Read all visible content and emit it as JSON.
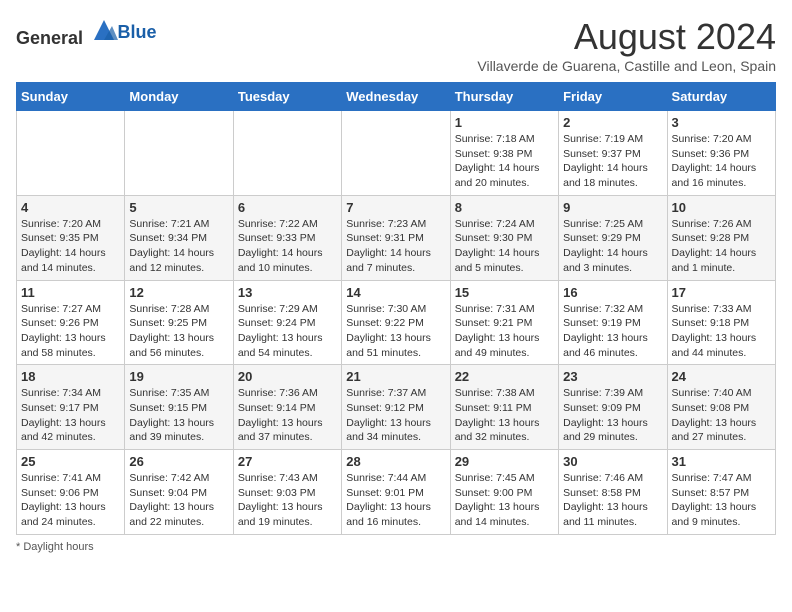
{
  "header": {
    "logo_general": "General",
    "logo_blue": "Blue",
    "month_title": "August 2024",
    "subtitle": "Villaverde de Guarena, Castille and Leon, Spain"
  },
  "weekdays": [
    "Sunday",
    "Monday",
    "Tuesday",
    "Wednesday",
    "Thursday",
    "Friday",
    "Saturday"
  ],
  "weeks": [
    [
      {
        "day": "",
        "sunrise": "",
        "sunset": "",
        "daylight": ""
      },
      {
        "day": "",
        "sunrise": "",
        "sunset": "",
        "daylight": ""
      },
      {
        "day": "",
        "sunrise": "",
        "sunset": "",
        "daylight": ""
      },
      {
        "day": "",
        "sunrise": "",
        "sunset": "",
        "daylight": ""
      },
      {
        "day": "1",
        "sunrise": "Sunrise: 7:18 AM",
        "sunset": "Sunset: 9:38 PM",
        "daylight": "Daylight: 14 hours and 20 minutes."
      },
      {
        "day": "2",
        "sunrise": "Sunrise: 7:19 AM",
        "sunset": "Sunset: 9:37 PM",
        "daylight": "Daylight: 14 hours and 18 minutes."
      },
      {
        "day": "3",
        "sunrise": "Sunrise: 7:20 AM",
        "sunset": "Sunset: 9:36 PM",
        "daylight": "Daylight: 14 hours and 16 minutes."
      }
    ],
    [
      {
        "day": "4",
        "sunrise": "Sunrise: 7:20 AM",
        "sunset": "Sunset: 9:35 PM",
        "daylight": "Daylight: 14 hours and 14 minutes."
      },
      {
        "day": "5",
        "sunrise": "Sunrise: 7:21 AM",
        "sunset": "Sunset: 9:34 PM",
        "daylight": "Daylight: 14 hours and 12 minutes."
      },
      {
        "day": "6",
        "sunrise": "Sunrise: 7:22 AM",
        "sunset": "Sunset: 9:33 PM",
        "daylight": "Daylight: 14 hours and 10 minutes."
      },
      {
        "day": "7",
        "sunrise": "Sunrise: 7:23 AM",
        "sunset": "Sunset: 9:31 PM",
        "daylight": "Daylight: 14 hours and 7 minutes."
      },
      {
        "day": "8",
        "sunrise": "Sunrise: 7:24 AM",
        "sunset": "Sunset: 9:30 PM",
        "daylight": "Daylight: 14 hours and 5 minutes."
      },
      {
        "day": "9",
        "sunrise": "Sunrise: 7:25 AM",
        "sunset": "Sunset: 9:29 PM",
        "daylight": "Daylight: 14 hours and 3 minutes."
      },
      {
        "day": "10",
        "sunrise": "Sunrise: 7:26 AM",
        "sunset": "Sunset: 9:28 PM",
        "daylight": "Daylight: 14 hours and 1 minute."
      }
    ],
    [
      {
        "day": "11",
        "sunrise": "Sunrise: 7:27 AM",
        "sunset": "Sunset: 9:26 PM",
        "daylight": "Daylight: 13 hours and 58 minutes."
      },
      {
        "day": "12",
        "sunrise": "Sunrise: 7:28 AM",
        "sunset": "Sunset: 9:25 PM",
        "daylight": "Daylight: 13 hours and 56 minutes."
      },
      {
        "day": "13",
        "sunrise": "Sunrise: 7:29 AM",
        "sunset": "Sunset: 9:24 PM",
        "daylight": "Daylight: 13 hours and 54 minutes."
      },
      {
        "day": "14",
        "sunrise": "Sunrise: 7:30 AM",
        "sunset": "Sunset: 9:22 PM",
        "daylight": "Daylight: 13 hours and 51 minutes."
      },
      {
        "day": "15",
        "sunrise": "Sunrise: 7:31 AM",
        "sunset": "Sunset: 9:21 PM",
        "daylight": "Daylight: 13 hours and 49 minutes."
      },
      {
        "day": "16",
        "sunrise": "Sunrise: 7:32 AM",
        "sunset": "Sunset: 9:19 PM",
        "daylight": "Daylight: 13 hours and 46 minutes."
      },
      {
        "day": "17",
        "sunrise": "Sunrise: 7:33 AM",
        "sunset": "Sunset: 9:18 PM",
        "daylight": "Daylight: 13 hours and 44 minutes."
      }
    ],
    [
      {
        "day": "18",
        "sunrise": "Sunrise: 7:34 AM",
        "sunset": "Sunset: 9:17 PM",
        "daylight": "Daylight: 13 hours and 42 minutes."
      },
      {
        "day": "19",
        "sunrise": "Sunrise: 7:35 AM",
        "sunset": "Sunset: 9:15 PM",
        "daylight": "Daylight: 13 hours and 39 minutes."
      },
      {
        "day": "20",
        "sunrise": "Sunrise: 7:36 AM",
        "sunset": "Sunset: 9:14 PM",
        "daylight": "Daylight: 13 hours and 37 minutes."
      },
      {
        "day": "21",
        "sunrise": "Sunrise: 7:37 AM",
        "sunset": "Sunset: 9:12 PM",
        "daylight": "Daylight: 13 hours and 34 minutes."
      },
      {
        "day": "22",
        "sunrise": "Sunrise: 7:38 AM",
        "sunset": "Sunset: 9:11 PM",
        "daylight": "Daylight: 13 hours and 32 minutes."
      },
      {
        "day": "23",
        "sunrise": "Sunrise: 7:39 AM",
        "sunset": "Sunset: 9:09 PM",
        "daylight": "Daylight: 13 hours and 29 minutes."
      },
      {
        "day": "24",
        "sunrise": "Sunrise: 7:40 AM",
        "sunset": "Sunset: 9:08 PM",
        "daylight": "Daylight: 13 hours and 27 minutes."
      }
    ],
    [
      {
        "day": "25",
        "sunrise": "Sunrise: 7:41 AM",
        "sunset": "Sunset: 9:06 PM",
        "daylight": "Daylight: 13 hours and 24 minutes."
      },
      {
        "day": "26",
        "sunrise": "Sunrise: 7:42 AM",
        "sunset": "Sunset: 9:04 PM",
        "daylight": "Daylight: 13 hours and 22 minutes."
      },
      {
        "day": "27",
        "sunrise": "Sunrise: 7:43 AM",
        "sunset": "Sunset: 9:03 PM",
        "daylight": "Daylight: 13 hours and 19 minutes."
      },
      {
        "day": "28",
        "sunrise": "Sunrise: 7:44 AM",
        "sunset": "Sunset: 9:01 PM",
        "daylight": "Daylight: 13 hours and 16 minutes."
      },
      {
        "day": "29",
        "sunrise": "Sunrise: 7:45 AM",
        "sunset": "Sunset: 9:00 PM",
        "daylight": "Daylight: 13 hours and 14 minutes."
      },
      {
        "day": "30",
        "sunrise": "Sunrise: 7:46 AM",
        "sunset": "Sunset: 8:58 PM",
        "daylight": "Daylight: 13 hours and 11 minutes."
      },
      {
        "day": "31",
        "sunrise": "Sunrise: 7:47 AM",
        "sunset": "Sunset: 8:57 PM",
        "daylight": "Daylight: 13 hours and 9 minutes."
      }
    ]
  ],
  "footer": {
    "note": "Daylight hours"
  }
}
